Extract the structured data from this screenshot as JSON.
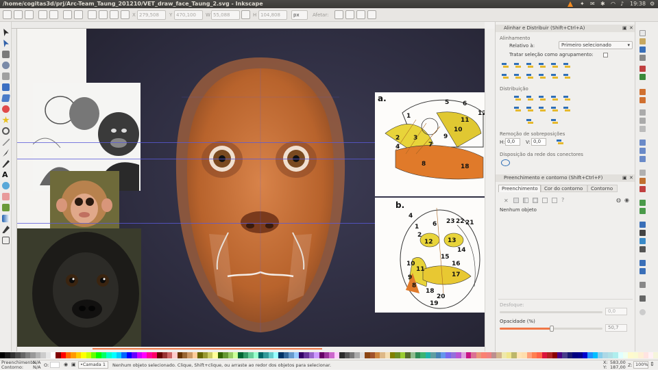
{
  "window": {
    "title": "/home/cogitas3d/prj/Arc-Team_Taung_201210/VET_draw_face_Taung_2.svg - Inkscape",
    "clock": "19:38"
  },
  "controls": {
    "x_label": "X",
    "x_value": "279,508",
    "y_label": "Y",
    "y_value": "470,100",
    "w_label": "W",
    "w_value": "55,088",
    "h_label": "H",
    "h_value": "104,808",
    "unit": "px",
    "affect_label": "Afetar:"
  },
  "align": {
    "title": "Alinhar e Distribuir (Shift+Ctrl+A)",
    "section_align": "Alinhamento",
    "relative_label": "Relativo à:",
    "relative_value": "Primeiro selecionado",
    "group_label": "Tratar seleção como agrupamento:",
    "section_distribute": "Distribuição",
    "section_overlap": "Remoção de sobreposições",
    "h_label": "H:",
    "h_value": "0,0",
    "v_label": "V:",
    "v_value": "0,0",
    "section_connectors": "Disposição da rede dos conectores"
  },
  "fill": {
    "title": "Preenchimento e contorno (Shift+Ctrl+F)",
    "tab_fill": "Preenchimento",
    "tab_stroke_paint": "Cor do contorno",
    "tab_stroke_style": "Contorno",
    "no_object": "Nenhum objeto",
    "blur_label": "Desfoque:",
    "blur_value": "0,0",
    "opacity_label": "Opacidade (%)",
    "opacity_value": "50,7",
    "opacity_level": 0.507
  },
  "figures": {
    "label_a": "a.",
    "label_b": "b.",
    "numbers_a": [
      "5",
      "6",
      "12",
      "1",
      "3",
      "7",
      "11",
      "10",
      "9",
      "2",
      "4",
      "8",
      "18"
    ],
    "numbers_b": [
      "4",
      "6",
      "23",
      "22",
      "21",
      "1",
      "2",
      "12",
      "13",
      "14",
      "15",
      "16",
      "10",
      "9",
      "11",
      "8",
      "17",
      "18",
      "20",
      "19"
    ]
  },
  "status": {
    "fill_label": "Preenchimento:",
    "fill_value": "N/A",
    "stroke_label": "Contorno:",
    "stroke_value": "N/A",
    "opacity_label": "O:",
    "layer": "•Camada 1",
    "message": "Nenhum objeto selecionado. Clique, Shift+clique, ou arraste ao redor dos objetos para selecionar.",
    "x_label": "X:",
    "x_value": "583,00",
    "y_label": "Y:",
    "y_value": "187,00",
    "z_label": "Z:",
    "zoom": "100%"
  },
  "colors": {
    "accent": "#f07746",
    "canvas_bg": "#2d2c3f",
    "face": "#c76a32",
    "guide": "#5a5ad8"
  }
}
